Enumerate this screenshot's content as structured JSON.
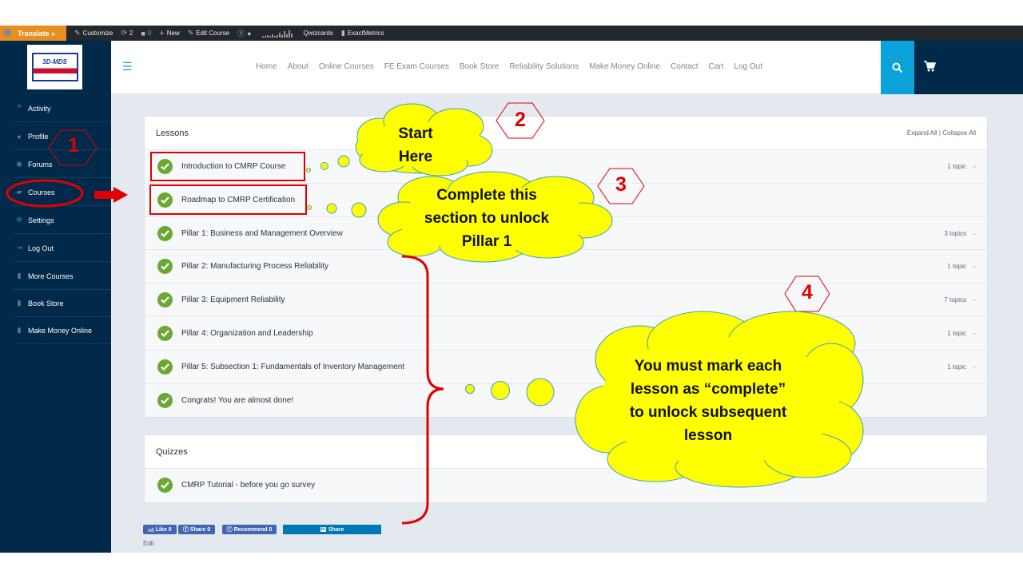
{
  "admin_bar": {
    "translate": "Translate »",
    "customize": "Customize",
    "updates_count": "2",
    "comments_count": "0",
    "new": "New",
    "edit_course": "Edit Course",
    "qwizcards": "Qwizcards",
    "exactmetrics": "ExactMetrics"
  },
  "logo_text": "3D-MDS",
  "sidebar": {
    "items": [
      {
        "label": "Activity",
        "icon": "activity-icon"
      },
      {
        "label": "Profile",
        "icon": "user-icon"
      },
      {
        "label": "Forums",
        "icon": "chat-icon"
      },
      {
        "label": "Courses",
        "icon": "graduation-cap-icon"
      },
      {
        "label": "Settings",
        "icon": "gear-icon"
      },
      {
        "label": "Log Out",
        "icon": "logout-icon"
      },
      {
        "label": "More Courses",
        "icon": "document-icon"
      },
      {
        "label": "Book Store",
        "icon": "document-icon"
      },
      {
        "label": "Make Money Online",
        "icon": "document-icon"
      }
    ]
  },
  "nav": {
    "items": [
      "Home",
      "About",
      "Online Courses",
      "FE Exam Courses",
      "Book Store",
      "Reliability Solutions",
      "Make Money Online",
      "Contact",
      "Cart",
      "Log Out"
    ]
  },
  "lessons": {
    "title": "Lessons",
    "expand_all": "Expand All | Collapse All",
    "rows": [
      {
        "label": "Introduction to CMRP Course",
        "topics": "1 topic"
      },
      {
        "label": "Roadmap to CMRP Certification",
        "topics": ""
      },
      {
        "label": "Pillar 1: Business and Management Overview",
        "topics": "3 topics"
      },
      {
        "label": "Pillar 2: Manufacturing Process Reliability",
        "topics": "1 topic"
      },
      {
        "label": "Pillar 3: Equipment Reliability",
        "topics": "7 topics"
      },
      {
        "label": "Pillar 4: Organization and Leadership",
        "topics": "1 topic"
      },
      {
        "label": "Pillar 5: Subsection 1: Fundamentals of Inventory Management",
        "topics": "1 topic"
      },
      {
        "label": "Congrats! You are almost done!",
        "topics": ""
      }
    ]
  },
  "quizzes": {
    "title": "Quizzes",
    "rows": [
      {
        "label": "CMRP Tutorial - before you go survey"
      }
    ]
  },
  "social": {
    "like": "Like 0",
    "share_fb": "Share 0",
    "recommend": "Recommend 0",
    "share_li": "Share"
  },
  "edit_link": "Edit",
  "annotations": {
    "num1": "1",
    "num2": "2",
    "num3": "3",
    "num4": "4",
    "cloud_start_line1": "Start",
    "cloud_start_line2": "Here",
    "cloud_complete_line1": "Complete this",
    "cloud_complete_line2": "section to unlock",
    "cloud_complete_line3": "Pillar 1",
    "cloud_mark_line1": "You must mark each",
    "cloud_mark_line2": "lesson as “complete”",
    "cloud_mark_line3": "to unlock subsequent",
    "cloud_mark_line4": "lesson"
  },
  "colors": {
    "sidebar_bg": "#012a4a",
    "accent_blue": "#0aa2d9",
    "check_green": "#6aa832",
    "annotation_red": "#e00000",
    "cloud_yellow": "#ffff00"
  }
}
